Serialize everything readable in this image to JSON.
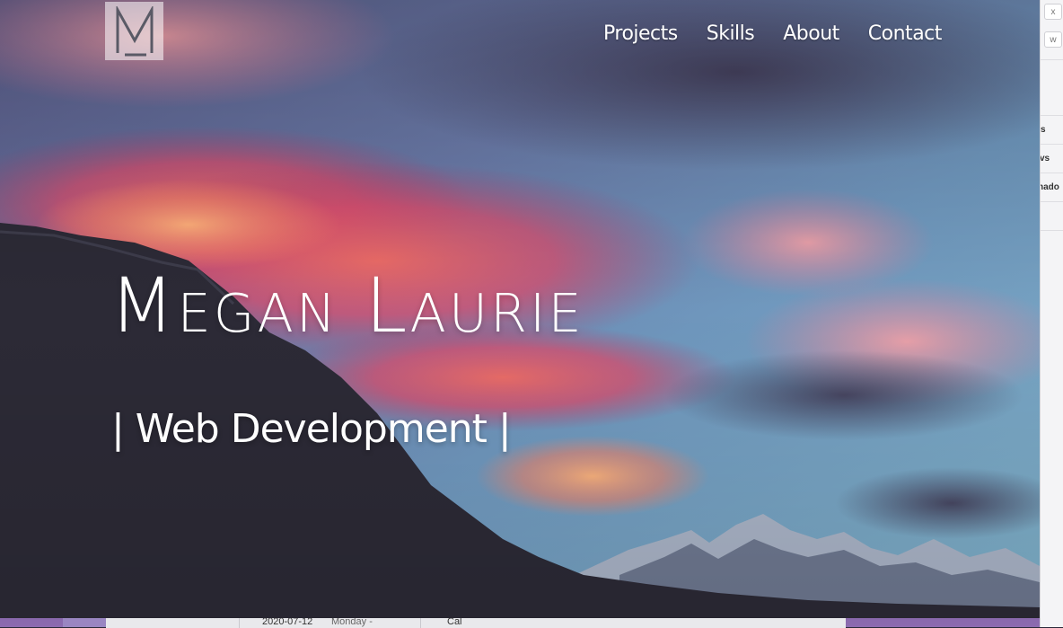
{
  "logo": {
    "letter": "M"
  },
  "nav": {
    "items": [
      {
        "label": "Projects"
      },
      {
        "label": "Skills"
      },
      {
        "label": "About"
      },
      {
        "label": "Contact"
      }
    ]
  },
  "hero": {
    "name": "Megan Laurie",
    "tagline": "| Web Development |"
  },
  "background_window": {
    "close_label": "x",
    "w_label": "w",
    "rows": [
      "s",
      "vs",
      "hado"
    ],
    "bottom_date": "2020-07-12",
    "bottom_day": "Monday -",
    "bottom_other": "Cal"
  },
  "colors": {
    "text": "#ffffff",
    "mountain": "#2c2a36",
    "sky_blue": "#5a8fb5",
    "cloud_red": "#e0506a",
    "cloud_orange": "#f0905a"
  }
}
